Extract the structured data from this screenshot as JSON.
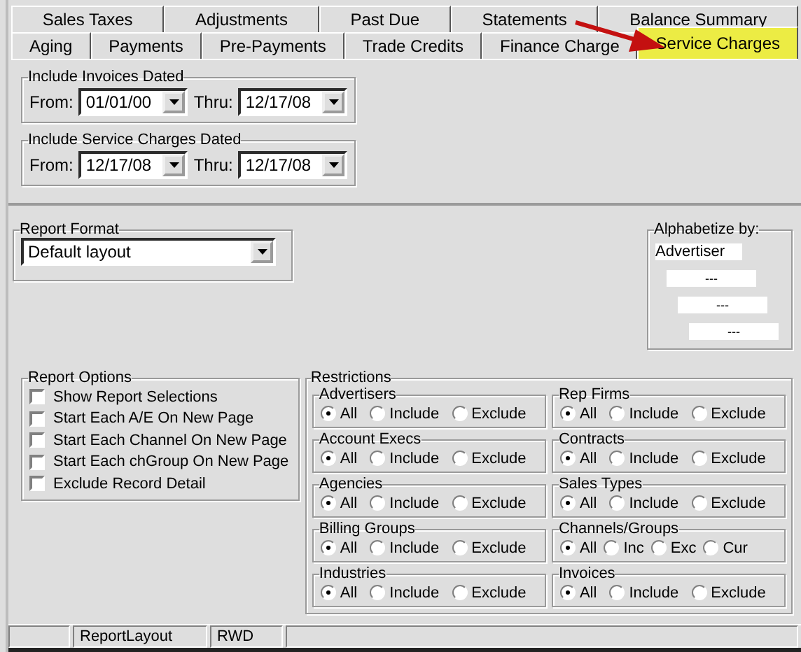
{
  "tabs": {
    "back_row": [
      {
        "label": "Sales Taxes",
        "selected": false
      },
      {
        "label": "Adjustments",
        "selected": false
      },
      {
        "label": "Past Due",
        "selected": false
      },
      {
        "label": "Statements",
        "selected": false
      },
      {
        "label": "Balance Summary",
        "selected": false
      }
    ],
    "front_row": [
      {
        "label": "Aging",
        "selected": false
      },
      {
        "label": "Payments",
        "selected": false
      },
      {
        "label": "Pre-Payments",
        "selected": false
      },
      {
        "label": "Trade Credits",
        "selected": false
      },
      {
        "label": "Finance Charge",
        "selected": false
      },
      {
        "label": "Service Charges",
        "selected": true
      }
    ]
  },
  "date_ranges": [
    {
      "title": "Include Invoices Dated",
      "from_label": "From:",
      "from": "01/01/00",
      "thru_label": "Thru:",
      "thru": "12/17/08"
    },
    {
      "title": "Include Service Charges Dated",
      "from_label": "From:",
      "from": "12/17/08",
      "thru_label": "Thru:",
      "thru": "12/17/08"
    }
  ],
  "report_format": {
    "title": "Report Format",
    "value": "Default layout"
  },
  "alphabetize": {
    "title": "Alphabetize by:",
    "fields": [
      "Advertiser",
      "---",
      "---",
      "---"
    ]
  },
  "report_options": {
    "title": "Report Options",
    "items": [
      {
        "label": "Show Report Selections",
        "checked": false
      },
      {
        "label": "Start Each A/E On New Page",
        "checked": false
      },
      {
        "label": "Start Each Channel On New Page",
        "checked": false
      },
      {
        "label": "Start Each chGroup On New Page",
        "checked": false
      },
      {
        "label": "Exclude Record Detail",
        "checked": false
      }
    ]
  },
  "restrictions": {
    "title": "Restrictions",
    "groups": [
      {
        "name": "Advertisers",
        "options": [
          {
            "label": "All",
            "selected": true
          },
          {
            "label": "Include",
            "selected": false
          },
          {
            "label": "Exclude",
            "selected": false
          }
        ]
      },
      {
        "name": "Rep Firms",
        "options": [
          {
            "label": "All",
            "selected": true
          },
          {
            "label": "Include",
            "selected": false
          },
          {
            "label": "Exclude",
            "selected": false
          }
        ]
      },
      {
        "name": "Account Execs",
        "options": [
          {
            "label": "All",
            "selected": true
          },
          {
            "label": "Include",
            "selected": false
          },
          {
            "label": "Exclude",
            "selected": false
          }
        ]
      },
      {
        "name": "Contracts",
        "options": [
          {
            "label": "All",
            "selected": true
          },
          {
            "label": "Include",
            "selected": false
          },
          {
            "label": "Exclude",
            "selected": false
          }
        ]
      },
      {
        "name": "Agencies",
        "options": [
          {
            "label": "All",
            "selected": true
          },
          {
            "label": "Include",
            "selected": false
          },
          {
            "label": "Exclude",
            "selected": false
          }
        ]
      },
      {
        "name": "Sales Types",
        "options": [
          {
            "label": "All",
            "selected": true
          },
          {
            "label": "Include",
            "selected": false
          },
          {
            "label": "Exclude",
            "selected": false
          }
        ]
      },
      {
        "name": "Billing Groups",
        "options": [
          {
            "label": "All",
            "selected": true
          },
          {
            "label": "Include",
            "selected": false
          },
          {
            "label": "Exclude",
            "selected": false
          }
        ]
      },
      {
        "name": "Channels/Groups",
        "options": [
          {
            "label": "All",
            "selected": true
          },
          {
            "label": "Inc",
            "selected": false
          },
          {
            "label": "Exc",
            "selected": false
          },
          {
            "label": "Cur",
            "selected": false
          }
        ]
      },
      {
        "name": "Industries",
        "options": [
          {
            "label": "All",
            "selected": true
          },
          {
            "label": "Include",
            "selected": false
          },
          {
            "label": "Exclude",
            "selected": false
          }
        ]
      },
      {
        "name": "Invoices",
        "options": [
          {
            "label": "All",
            "selected": true
          },
          {
            "label": "Include",
            "selected": false
          },
          {
            "label": "Exclude",
            "selected": false
          }
        ]
      }
    ]
  },
  "status_bar": [
    "ReportLayout",
    "RWD"
  ]
}
